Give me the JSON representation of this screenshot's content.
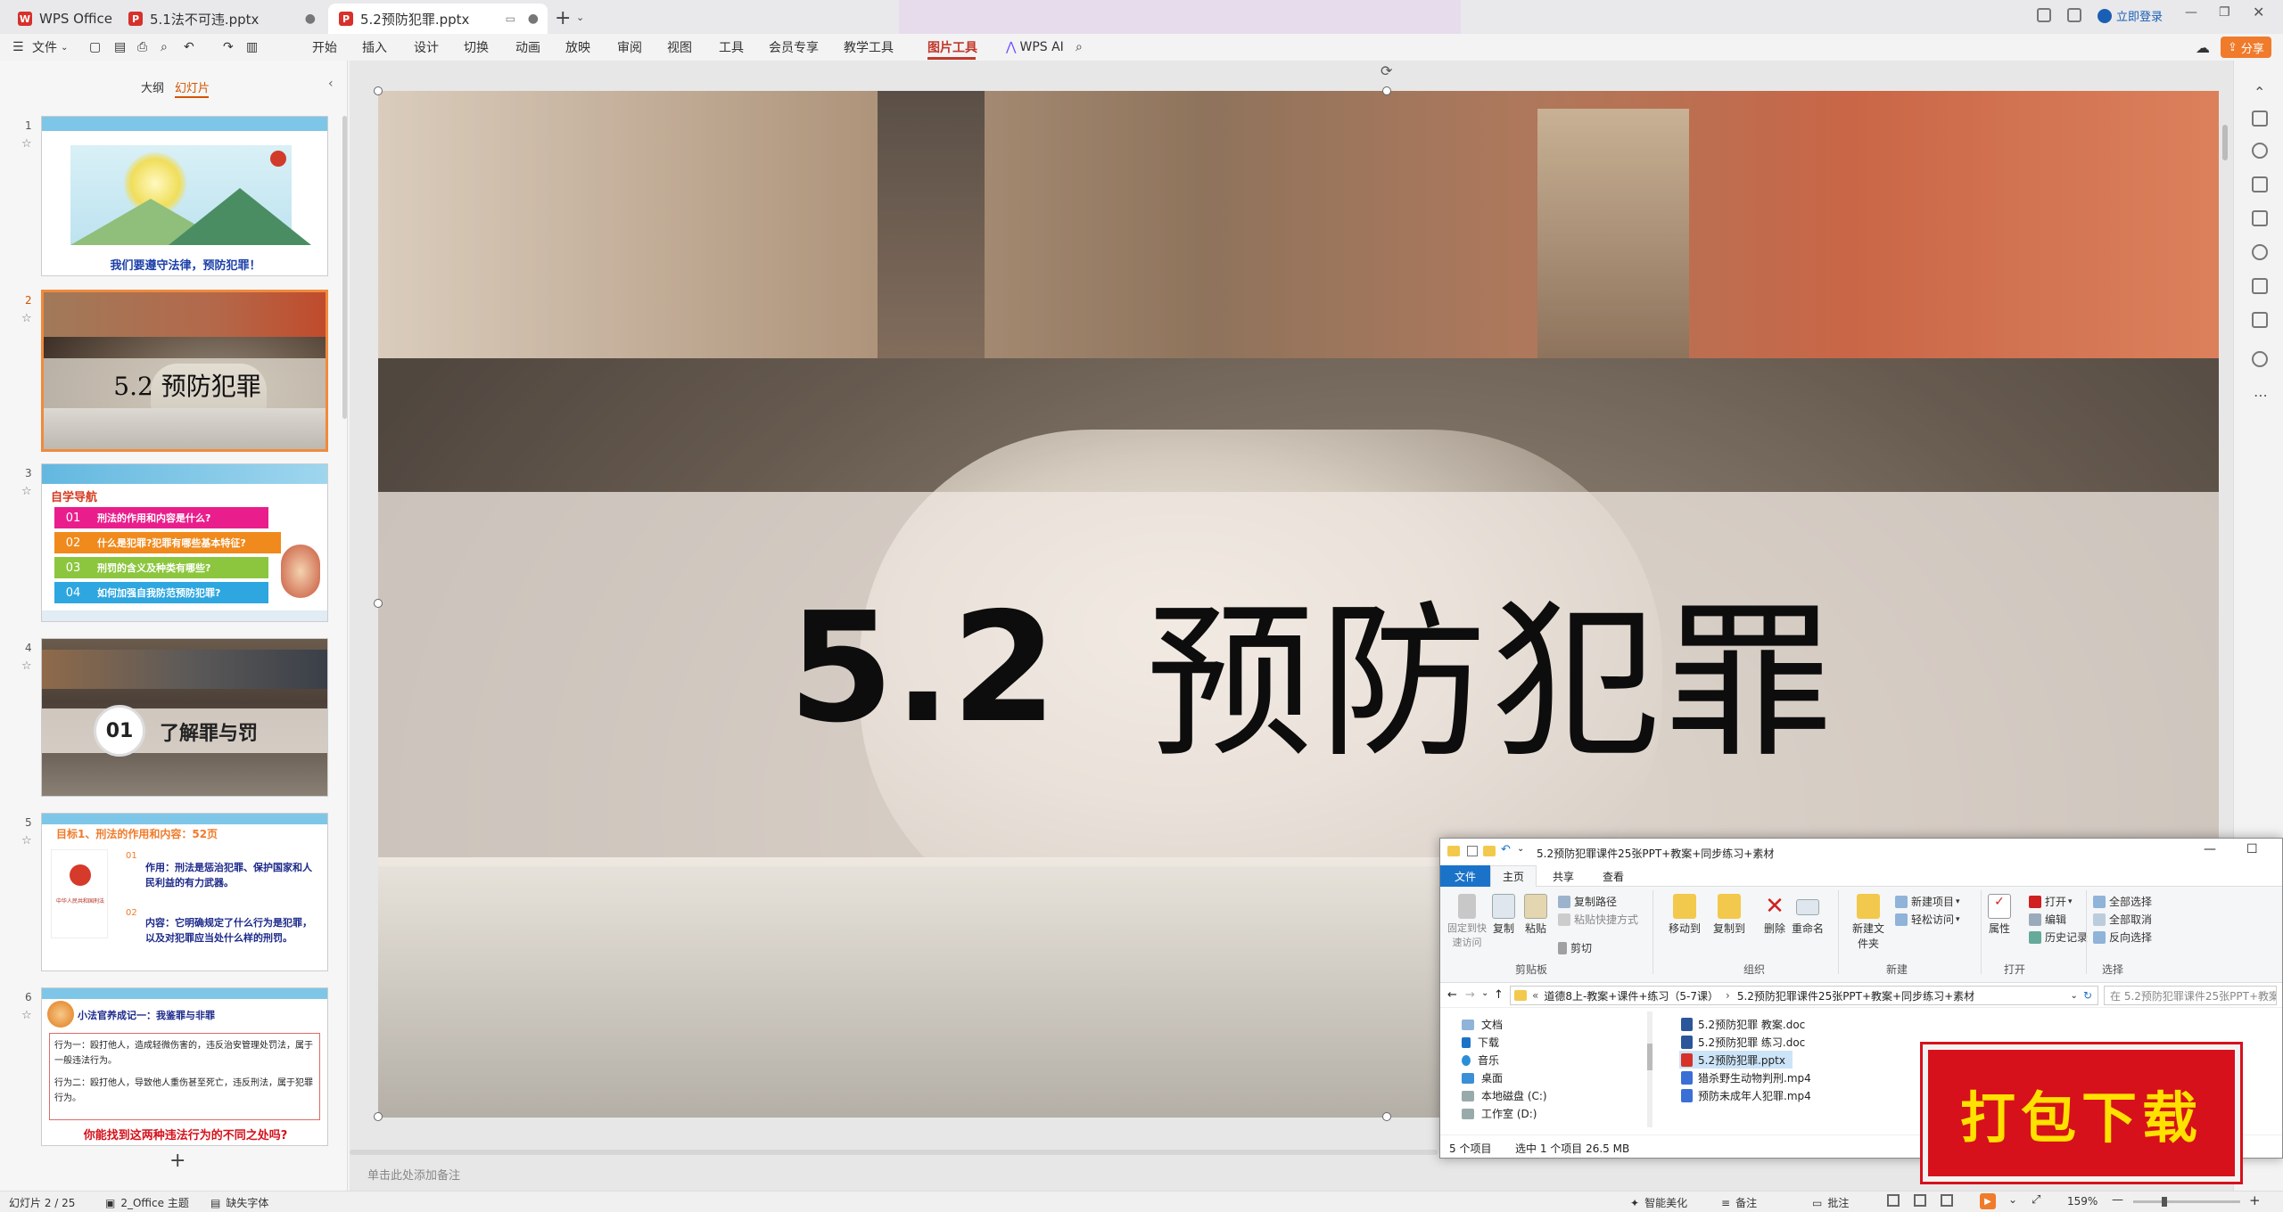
{
  "tabs": [
    {
      "label": "WPS Office"
    },
    {
      "label": "5.1法不可违.pptx"
    },
    {
      "label": "5.2预防犯罪.pptx"
    }
  ],
  "titlebar": {
    "login_label": "立即登录",
    "share_label": "分享"
  },
  "menu": {
    "file": "文件",
    "items": [
      "开始",
      "插入",
      "设计",
      "切换",
      "动画",
      "放映",
      "审阅",
      "视图",
      "工具",
      "会员专享",
      "教学工具"
    ],
    "picture_tools": "图片工具",
    "wps_ai": "WPS AI"
  },
  "left_panel": {
    "tab_outline": "大纲",
    "tab_slides": "幻灯片",
    "add_slide": "+"
  },
  "slides": {
    "numbers": [
      "1",
      "2",
      "3",
      "4",
      "5",
      "6"
    ],
    "s1": {
      "caption": "我们要遵守法律，预防犯罪！"
    },
    "s2": {
      "title": "5.2 预防犯罪"
    },
    "s3": {
      "header": "自学导航",
      "items": [
        {
          "num": "01",
          "text": "刑法的作用和内容是什么?"
        },
        {
          "num": "02",
          "text": "什么是犯罪?犯罪有哪些基本特征?"
        },
        {
          "num": "03",
          "text": "刑罚的含义及种类有哪些?"
        },
        {
          "num": "04",
          "text": "如何加强自我防范预防犯罪?"
        }
      ]
    },
    "s4": {
      "num": "01",
      "title": "了解罪与罚"
    },
    "s5": {
      "header": "目标1、刑法的作用和内容：52页",
      "book_label": "中华人民共和国刑法",
      "n1": "01",
      "para1": "作用：刑法是惩治犯罪、保护国家和人民利益的有力武器。",
      "n2": "02",
      "para2": "内容：它明确规定了什么行为是犯罪，以及对犯罪应当处什么样的刑罚。"
    },
    "s6": {
      "header": "小法官养成记一：我鉴罪与非罪",
      "line1": "行为一：殴打他人，造成轻微伤害的，违反治安管理处罚法，属于一般违法行为。",
      "line2": "行为二：殴打他人，导致他人重伤甚至死亡，违反刑法，属于犯罪行为。",
      "question": "你能找到这两种违法行为的不同之处吗?"
    }
  },
  "main_slide": {
    "num": "5.2",
    "title": "预防犯罪"
  },
  "notes_placeholder": "单击此处添加备注",
  "status": {
    "slide_info": "幻灯片 2 / 25",
    "theme": "2_Office 主题",
    "missing_font": "缺失字体",
    "smart_beautify": "智能美化",
    "notes": "备注",
    "comments": "批注",
    "zoom": "159%"
  },
  "explorer": {
    "title": "5.2预防犯罪课件25张PPT+教案+同步练习+素材",
    "ribbon_tabs": [
      "文件",
      "主页",
      "共享",
      "查看"
    ],
    "clipboard": {
      "pin": "固定到快速访问",
      "copy": "复制",
      "paste": "粘贴",
      "copy_path": "复制路径",
      "paste_shortcut": "粘贴快捷方式",
      "cut": "剪切",
      "group": "剪贴板"
    },
    "organize": {
      "move_to": "移动到",
      "copy_to": "复制到",
      "delete": "删除",
      "rename": "重命名",
      "group": "组织"
    },
    "new": {
      "new_folder": "新建文件夹",
      "new_item": "新建项目",
      "easy_access": "轻松访问",
      "group": "新建"
    },
    "open": {
      "properties": "属性",
      "open": "打开",
      "edit": "编辑",
      "history": "历史记录",
      "group": "打开"
    },
    "select": {
      "select_all": "全部选择",
      "select_none": "全部取消",
      "invert": "反向选择",
      "group": "选择"
    },
    "address": {
      "part1": "道德8上-教案+课件+练习（5-7课）",
      "part2": "5.2预防犯罪课件25张PPT+教案+同步练习+素材",
      "search_placeholder": "在 5.2预防犯罪课件25张PPT+教案..."
    },
    "nav": [
      "文档",
      "下载",
      "音乐",
      "桌面",
      "本地磁盘 (C:)",
      "工作室 (D:)"
    ],
    "files": [
      "5.2预防犯罪   教案.doc",
      "5.2预防犯罪   练习.doc",
      "5.2预防犯罪.pptx",
      "猎杀野生动物判刑.mp4",
      "预防未成年人犯罪.mp4"
    ],
    "status": {
      "count": "5 个项目",
      "selected": "选中 1 个项目  26.5 MB"
    }
  },
  "download_badge": "打包下载",
  "colors": {
    "accent": "#c0392b",
    "wps_red": "#d6312b",
    "selected_border": "#f08a3c",
    "badge_red": "#d6111b",
    "badge_text": "#ffe100",
    "explorer_blue": "#1a73c9"
  }
}
